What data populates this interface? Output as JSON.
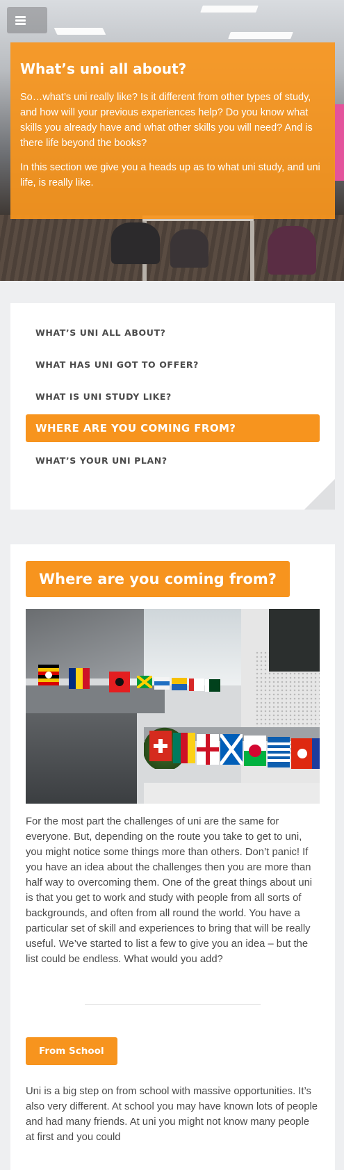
{
  "header": {
    "menu_icon": "hamburger-menu-icon"
  },
  "hero": {
    "title": "What’s uni all about?",
    "paragraphs": [
      "So…what’s uni really like? Is it different from other types of study, and how will your previous experiences help? Do you know what skills you already have and what other skills you will need? And is there life beyond the books?",
      "In this section we give you a heads up as to what uni study, and uni life, is really like."
    ]
  },
  "section_nav": {
    "items": [
      {
        "label": "WHAT’S UNI ALL ABOUT?",
        "active": false
      },
      {
        "label": "WHAT HAS UNI GOT TO OFFER?",
        "active": false
      },
      {
        "label": "WHAT IS UNI STUDY LIKE?",
        "active": false
      },
      {
        "label": "WHERE ARE YOU COMING FROM?",
        "active": true
      },
      {
        "label": "WHAT’S YOUR UNI PLAN?",
        "active": false
      }
    ]
  },
  "content": {
    "heading": "Where are you coming from?",
    "intro": "For the most part the challenges of uni are the same for everyone. But, depending on the route you take to get to uni, you might notice some things more than others. Don’t panic! If you have an idea about the challenges then you are more than half way to overcoming them. One of the great things about uni is that you get to work and study with people from all sorts of backgrounds, and often from all round the world. You have a particular set of skill and experiences to bring that will be really useful. We’ve started to list a few to give you an idea – but the list could be endless. What would you add?",
    "subsection_label": "From School",
    "subsection_text": "Uni is a big step on from school with massive opportunities. It’s also very different. At school you may have known lots of people and had many friends. At uni you might not know many people at first and you could"
  },
  "colors": {
    "accent": "#f7941e",
    "text": "#4a4a4a",
    "page_bg": "#eeeff1"
  }
}
